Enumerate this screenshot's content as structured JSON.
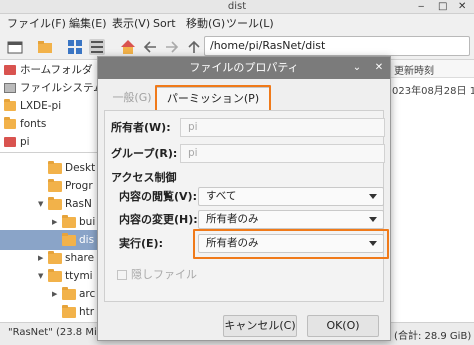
{
  "window": {
    "title": "dist"
  },
  "menu": [
    "ファイル(F)",
    "編集(E)",
    "表示(V)",
    "Sort",
    "移動(G)",
    "ツール(L)"
  ],
  "toolbar": {
    "path": "/home/pi/RasNet/dist"
  },
  "places": [
    {
      "label": "ホームフォルダ",
      "icon": "home-icon"
    },
    {
      "label": "ファイルシステム",
      "icon": "drive-icon"
    },
    {
      "label": "LXDE-pi",
      "icon": "folder-icon"
    },
    {
      "label": "fonts",
      "icon": "folder-icon"
    },
    {
      "label": "pi",
      "icon": "home-icon"
    }
  ],
  "tree": [
    {
      "label": "Deskt"
    },
    {
      "label": "Progr"
    },
    {
      "label": "RasN"
    },
    {
      "label": "bui"
    },
    {
      "label": "dis"
    },
    {
      "label": "share"
    },
    {
      "label": "ttymi"
    },
    {
      "label": "arc"
    },
    {
      "label": "htr"
    },
    {
      "label": ""
    }
  ],
  "file_list": {
    "column_header": "更新時刻",
    "modified": "023年08月28日 1"
  },
  "status": {
    "left": "\"RasNet\" (23.8 Mi",
    "right": "B (合計: 28.9 GiB)"
  },
  "dialog": {
    "title": "ファイルのプロパティ",
    "tabs": {
      "general": "一般(G)",
      "permissions": "パーミッション(P)"
    },
    "owner_label": "所有者(W):",
    "owner_value": "pi",
    "group_label": "グループ(R):",
    "group_value": "pi",
    "access_heading": "アクセス制御",
    "view_label": "内容の閲覧(V):",
    "view_value": "すべて",
    "change_label": "内容の変更(H):",
    "change_value": "所有者のみ",
    "execute_label": "実行(E):",
    "execute_value": "所有者のみ",
    "hidden_label": "隠しファイル",
    "cancel": "キャンセル(C)",
    "ok": "OK(O)"
  },
  "colors": {
    "highlight": "#f07a1a",
    "title_bar": "#7b7b7b",
    "selection": "#8aa4c8"
  }
}
